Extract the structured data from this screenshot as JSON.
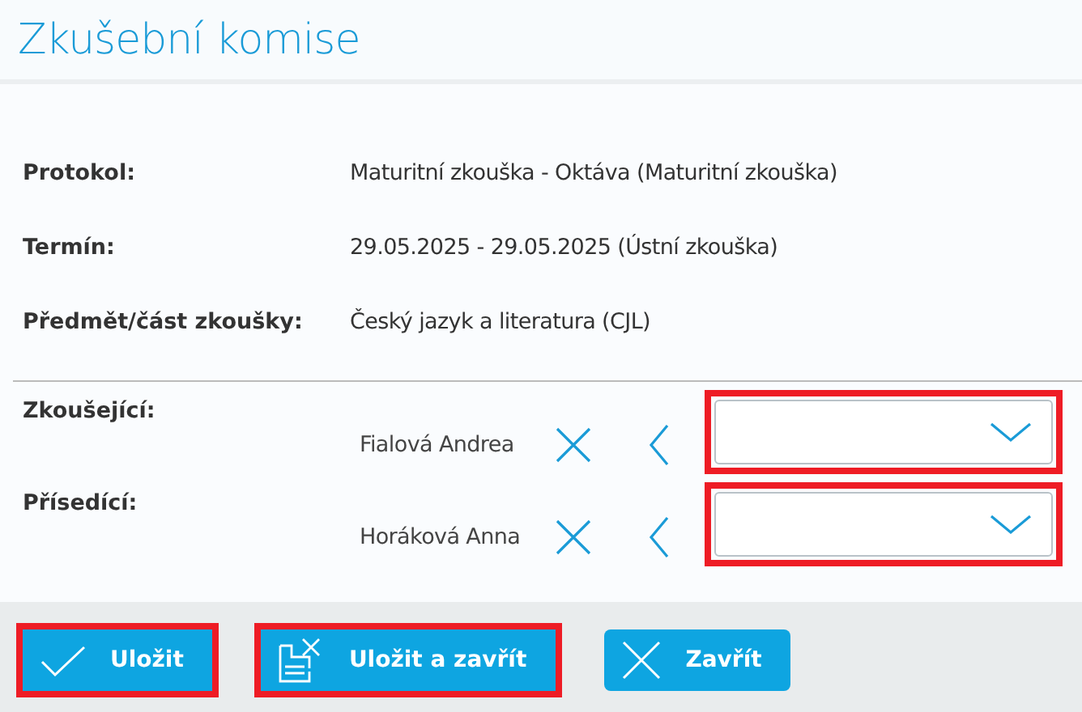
{
  "title": "Zkušební komise",
  "info": [
    {
      "label": "Protokol:",
      "value": "Maturitní zkouška - Oktáva (Maturitní zkouška)"
    },
    {
      "label": "Termín:",
      "value": "29.05.2025 - 29.05.2025 (Ústní zkouška)"
    },
    {
      "label": "Předmět/část zkoušky:",
      "value": "Český jazyk a literatura (CJL)"
    }
  ],
  "members": [
    {
      "label": "Zkoušející:",
      "name": "Fialová Andrea",
      "highlighted": true
    },
    {
      "label": "Přísedící:",
      "name": "Horáková Anna",
      "highlighted": true
    }
  ],
  "buttons": [
    {
      "label": "Uložit",
      "kind": "check",
      "highlighted": true
    },
    {
      "label": "Uložit a zavřít",
      "kind": "save-close",
      "highlighted": true
    },
    {
      "label": "Zavřít",
      "kind": "close",
      "highlighted": false
    }
  ]
}
